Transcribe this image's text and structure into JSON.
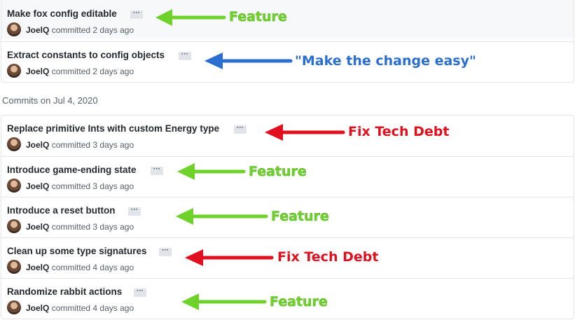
{
  "date_heading": "Commits on Jul 4, 2020",
  "ellipsis": "···",
  "verb": "committed",
  "groups": [
    {
      "commits": [
        {
          "title": "Make fox config editable",
          "author": "JoelQ",
          "when": "2 days ago",
          "tag": "Feature"
        },
        {
          "title": "Extract constants to config objects",
          "author": "JoelQ",
          "when": "2 days ago",
          "tag": "\"Make the change easy\""
        }
      ]
    },
    {
      "commits": [
        {
          "title": "Replace primitive Ints with custom Energy type",
          "author": "JoelQ",
          "when": "3 days ago",
          "tag": "Fix Tech Debt"
        },
        {
          "title": "Introduce game-ending state",
          "author": "JoelQ",
          "when": "3 days ago",
          "tag": "Feature"
        },
        {
          "title": "Introduce a reset button",
          "author": "JoelQ",
          "when": "3 days ago",
          "tag": "Feature"
        },
        {
          "title": "Clean up some type signatures",
          "author": "JoelQ",
          "when": "4 days ago",
          "tag": "Fix Tech Debt"
        },
        {
          "title": "Randomize rabbit actions",
          "author": "JoelQ",
          "when": "4 days ago",
          "tag": "Feature"
        }
      ]
    }
  ],
  "colors": {
    "feature": "#6fd22b",
    "tech_debt": "#e0101e",
    "make_easy": "#2a6fcf"
  }
}
